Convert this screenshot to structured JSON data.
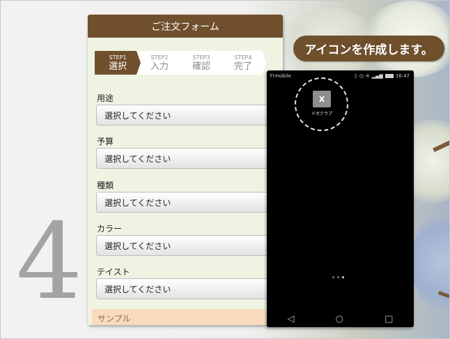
{
  "step_numeral": "4",
  "form": {
    "title": "ご注文フォーム",
    "steps": [
      {
        "num": "STEP1",
        "name": "選択"
      },
      {
        "num": "STEP2",
        "name": "入力"
      },
      {
        "num": "STEP3",
        "name": "確認"
      },
      {
        "num": "STEP4",
        "name": "完了"
      }
    ],
    "active_step": 1,
    "fields": [
      {
        "label": "用途",
        "value": "選択してください"
      },
      {
        "label": "予算",
        "value": "選択してください"
      },
      {
        "label": "種類",
        "value": "選択してください"
      },
      {
        "label": "カラー",
        "value": "選択してください"
      },
      {
        "label": "テイスト",
        "value": "選択してください"
      }
    ],
    "sample_label": "サンプル"
  },
  "phone": {
    "carrier": "Y!mobile",
    "time": "16:47",
    "app_icon_letter": "X",
    "app_label": "ドガクラブ",
    "nav": {
      "back": "◁",
      "home": "○",
      "recent": "□"
    }
  },
  "callout": {
    "text": "アイコンを作成します。"
  },
  "colors": {
    "brand": "#6f4f2c",
    "form_bg": "#eef3e2",
    "sample_bg": "#f9dcbf"
  }
}
